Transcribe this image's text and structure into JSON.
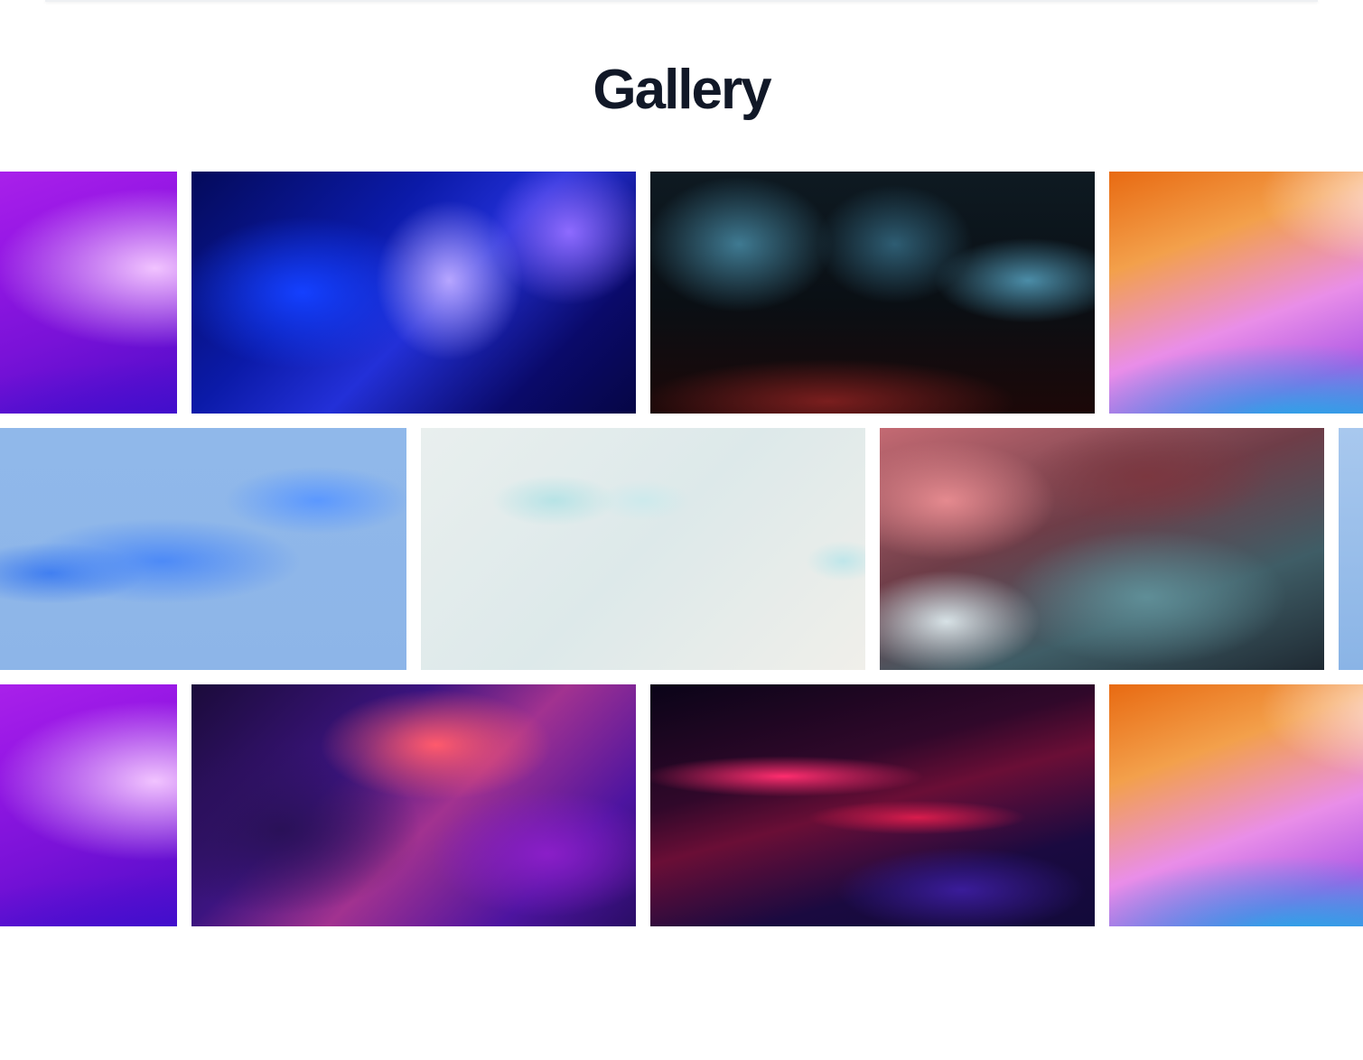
{
  "page": {
    "title": "Gallery"
  },
  "gallery": {
    "rows": [
      {
        "tiles": [
          {
            "artwork": "violet-gradient-waves"
          },
          {
            "artwork": "blue-fluid-waves"
          },
          {
            "artwork": "dark-ink-marbling"
          },
          {
            "artwork": "macos-gradient-waves"
          }
        ]
      },
      {
        "tiles": [
          {
            "artwork": "blue-ribbon-3d"
          },
          {
            "artwork": "milky-teal-swirl"
          },
          {
            "artwork": "pink-teal-smoke"
          },
          {
            "artwork": "light-blue-partial"
          }
        ]
      },
      {
        "tiles": [
          {
            "artwork": "violet-gradient-waves"
          },
          {
            "artwork": "purple-pink-dust"
          },
          {
            "artwork": "red-blue-streak"
          },
          {
            "artwork": "macos-gradient-waves"
          }
        ]
      }
    ]
  },
  "colors": {
    "title": "#111827",
    "background": "#ffffff"
  }
}
